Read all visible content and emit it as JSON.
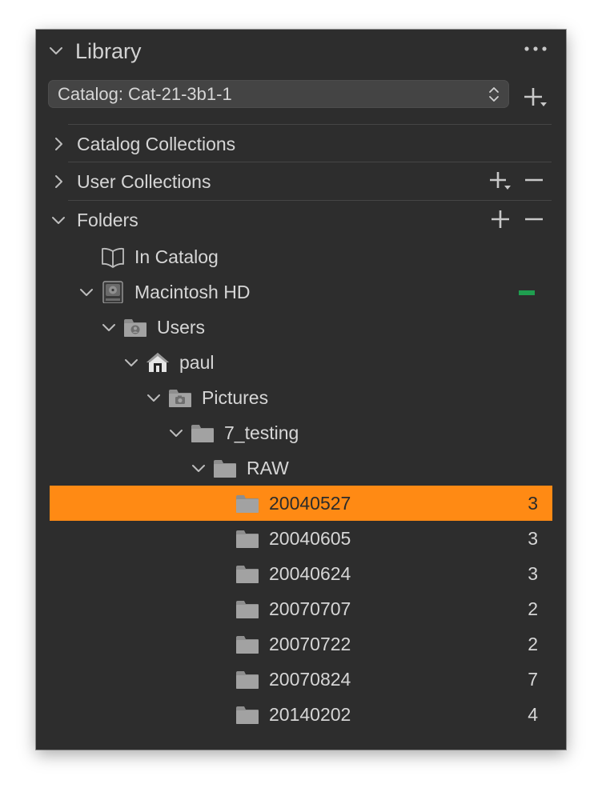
{
  "header": {
    "title": "Library",
    "more_icon": "ellipsis-icon"
  },
  "catalog": {
    "selected": "Catalog: Cat-21-3b1-1"
  },
  "sections": [
    {
      "label": "Catalog Collections",
      "expanded": false
    },
    {
      "label": "User Collections",
      "expanded": false
    },
    {
      "label": "Folders",
      "expanded": true
    }
  ],
  "tree": [
    {
      "label": "In Catalog",
      "icon": "book-icon",
      "depth": 0,
      "expanded": null,
      "count": ""
    },
    {
      "label": "Macintosh HD",
      "icon": "hard-drive-icon",
      "depth": 0,
      "expanded": true,
      "count": ""
    },
    {
      "label": "Users",
      "icon": "users-folder-icon",
      "depth": 1,
      "expanded": true,
      "count": ""
    },
    {
      "label": "paul",
      "icon": "home-icon",
      "depth": 2,
      "expanded": true,
      "count": ""
    },
    {
      "label": "Pictures",
      "icon": "pictures-folder-icon",
      "depth": 3,
      "expanded": true,
      "count": ""
    },
    {
      "label": "7_testing",
      "icon": "folder-icon",
      "depth": 4,
      "expanded": true,
      "count": ""
    },
    {
      "label": "RAW",
      "icon": "folder-icon",
      "depth": 5,
      "expanded": true,
      "count": ""
    },
    {
      "label": "20040527",
      "icon": "folder-icon",
      "depth": 6,
      "expanded": null,
      "count": "3",
      "selected": true
    },
    {
      "label": "20040605",
      "icon": "folder-icon",
      "depth": 6,
      "expanded": null,
      "count": "3"
    },
    {
      "label": "20040624",
      "icon": "folder-icon",
      "depth": 6,
      "expanded": null,
      "count": "3"
    },
    {
      "label": "20070707",
      "icon": "folder-icon",
      "depth": 6,
      "expanded": null,
      "count": "2"
    },
    {
      "label": "20070722",
      "icon": "folder-icon",
      "depth": 6,
      "expanded": null,
      "count": "2"
    },
    {
      "label": "20070824",
      "icon": "folder-icon",
      "depth": 6,
      "expanded": null,
      "count": "7"
    },
    {
      "label": "20140202",
      "icon": "folder-icon",
      "depth": 6,
      "expanded": null,
      "count": "4"
    }
  ],
  "colors": {
    "panel_bg": "#2d2d2d",
    "selection": "#ff8a14",
    "drive_status": "#1f9e4f",
    "text": "#d6d6d6"
  }
}
